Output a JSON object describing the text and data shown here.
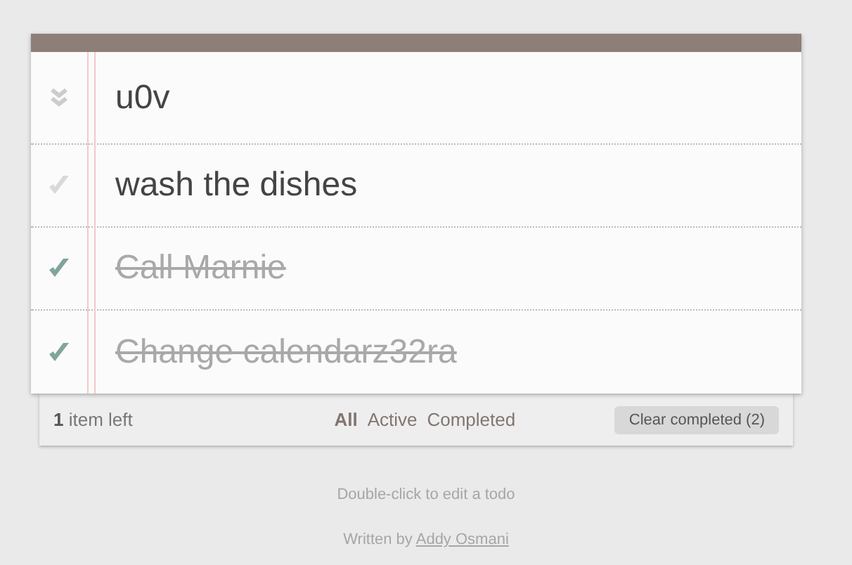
{
  "new_todo": {
    "value": "u0v",
    "toggle_all_checked": false
  },
  "todos": [
    {
      "title": "wash the dishes",
      "completed": false
    },
    {
      "title": "Call Marnie",
      "completed": true
    },
    {
      "title": "Change calendarz32ra",
      "completed": true
    }
  ],
  "footer": {
    "count": "**1** item left",
    "filters": [
      {
        "label": "All",
        "selected": true
      },
      {
        "label": "Active",
        "selected": false
      },
      {
        "label": "Completed",
        "selected": false
      }
    ],
    "clear_button": "Clear completed (2)"
  },
  "info": {
    "hint": "Double-click to edit a todo",
    "credit": "Written by",
    "author": "Addy Osmani"
  }
}
